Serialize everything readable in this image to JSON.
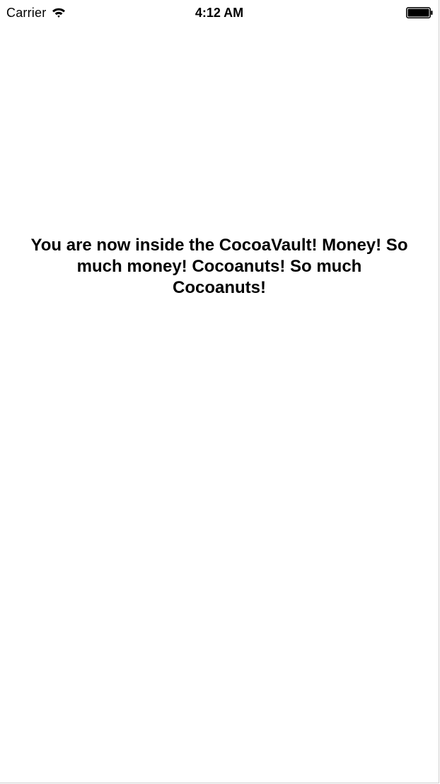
{
  "status_bar": {
    "carrier": "Carrier",
    "time": "4:12 AM",
    "icons": {
      "wifi": "wifi-icon",
      "battery": "battery-icon"
    }
  },
  "main": {
    "message": "You are now inside the CocoaVault! Money! So much money! Cocoanuts! So much Cocoanuts!"
  }
}
